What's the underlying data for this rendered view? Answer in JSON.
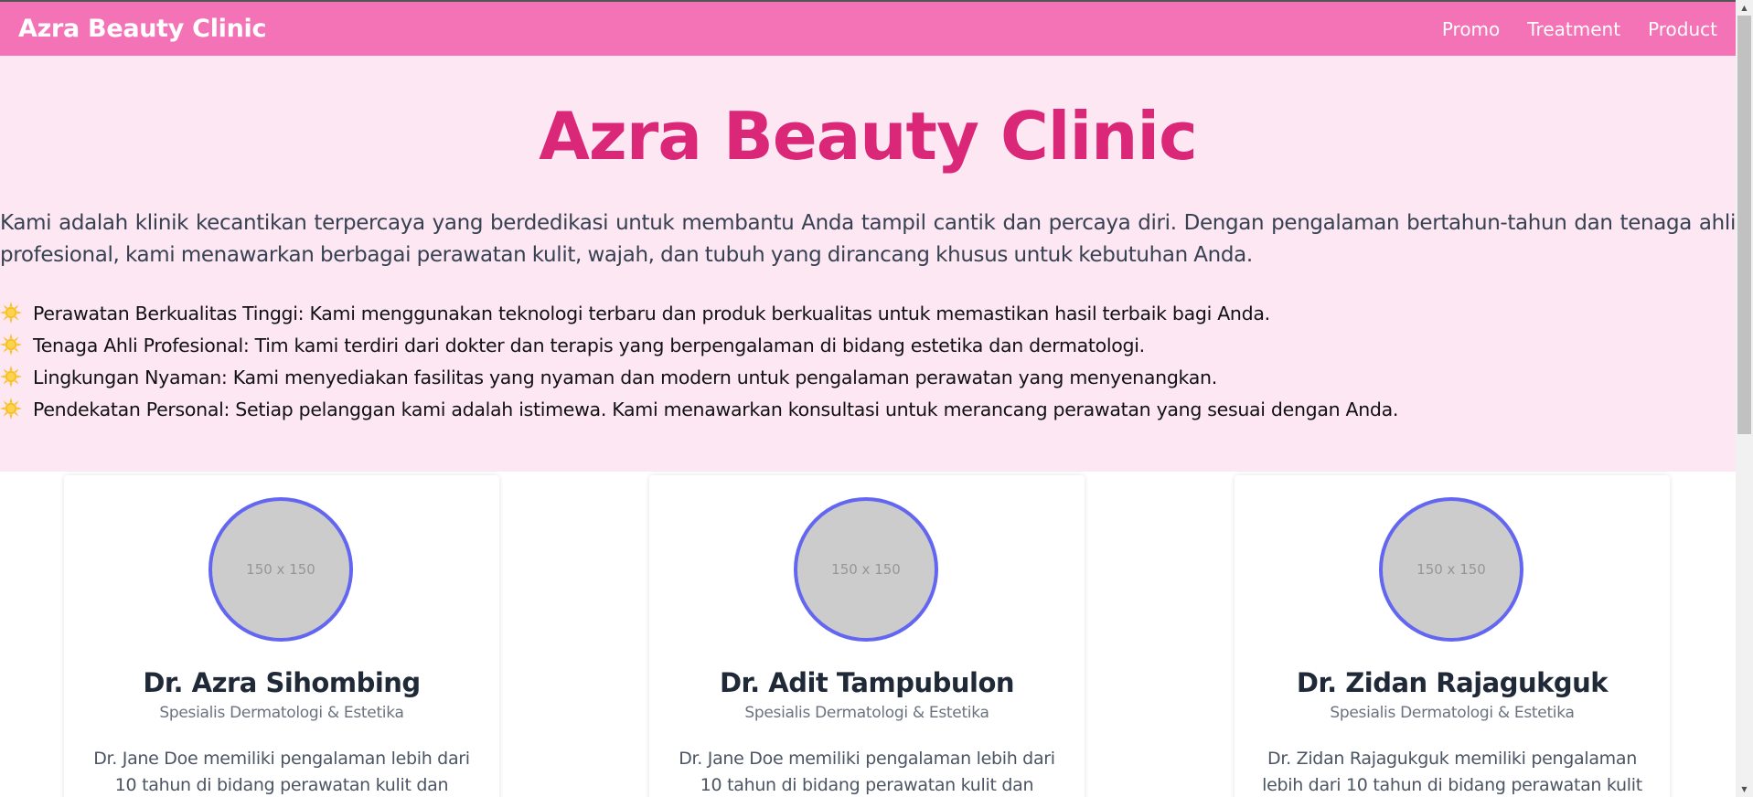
{
  "navbar": {
    "brand": "Azra Beauty Clinic",
    "links": [
      {
        "label": "Promo"
      },
      {
        "label": "Treatment"
      },
      {
        "label": "Product"
      }
    ]
  },
  "hero": {
    "title": "Azra Beauty Clinic",
    "description": "Kami adalah klinik kecantikan terpercaya yang berdedikasi untuk membantu Anda tampil cantik dan percaya diri. Dengan pengalaman bertahun-tahun dan tenaga ahli profesional, kami menawarkan berbagai perawatan kulit, wajah, dan tubuh yang dirancang khusus untuk kebutuhan Anda.",
    "features": [
      {
        "icon": "sun-emoji-icon",
        "text": "Perawatan Berkualitas Tinggi: Kami menggunakan teknologi terbaru dan produk berkualitas untuk memastikan hasil terbaik bagi Anda."
      },
      {
        "icon": "sun-emoji-icon",
        "text": "Tenaga Ahli Profesional: Tim kami terdiri dari dokter dan terapis yang berpengalaman di bidang estetika dan dermatologi."
      },
      {
        "icon": "sun-emoji-icon",
        "text": "Lingkungan Nyaman: Kami menyediakan fasilitas yang nyaman dan modern untuk pengalaman perawatan yang menyenangkan."
      },
      {
        "icon": "sun-emoji-icon",
        "text": "Pendekatan Personal: Setiap pelanggan kami adalah istimewa. Kami menawarkan konsultasi untuk merancang perawatan yang sesuai dengan Anda."
      }
    ]
  },
  "doctors": [
    {
      "placeholder": "150 x 150",
      "name": "Dr. Azra Sihombing",
      "specialty": "Spesialis Dermatologi & Estetika",
      "description": "Dr. Jane Doe memiliki pengalaman lebih dari 10 tahun di bidang perawatan kulit dan"
    },
    {
      "placeholder": "150 x 150",
      "name": "Dr. Adit Tampubulon",
      "specialty": "Spesialis Dermatologi & Estetika",
      "description": "Dr. Jane Doe memiliki pengalaman lebih dari 10 tahun di bidang perawatan kulit dan"
    },
    {
      "placeholder": "150 x 150",
      "name": "Dr. Zidan Rajagukguk",
      "specialty": "Spesialis Dermatologi & Estetika",
      "description": "Dr. Zidan Rajagukguk memiliki pengalaman lebih dari 10 tahun di bidang perawatan kulit"
    }
  ],
  "colors": {
    "navbar_bg": "#f472b6",
    "hero_bg": "#fce7f3",
    "hero_title": "#db2777",
    "avatar_border": "#6366f1"
  }
}
